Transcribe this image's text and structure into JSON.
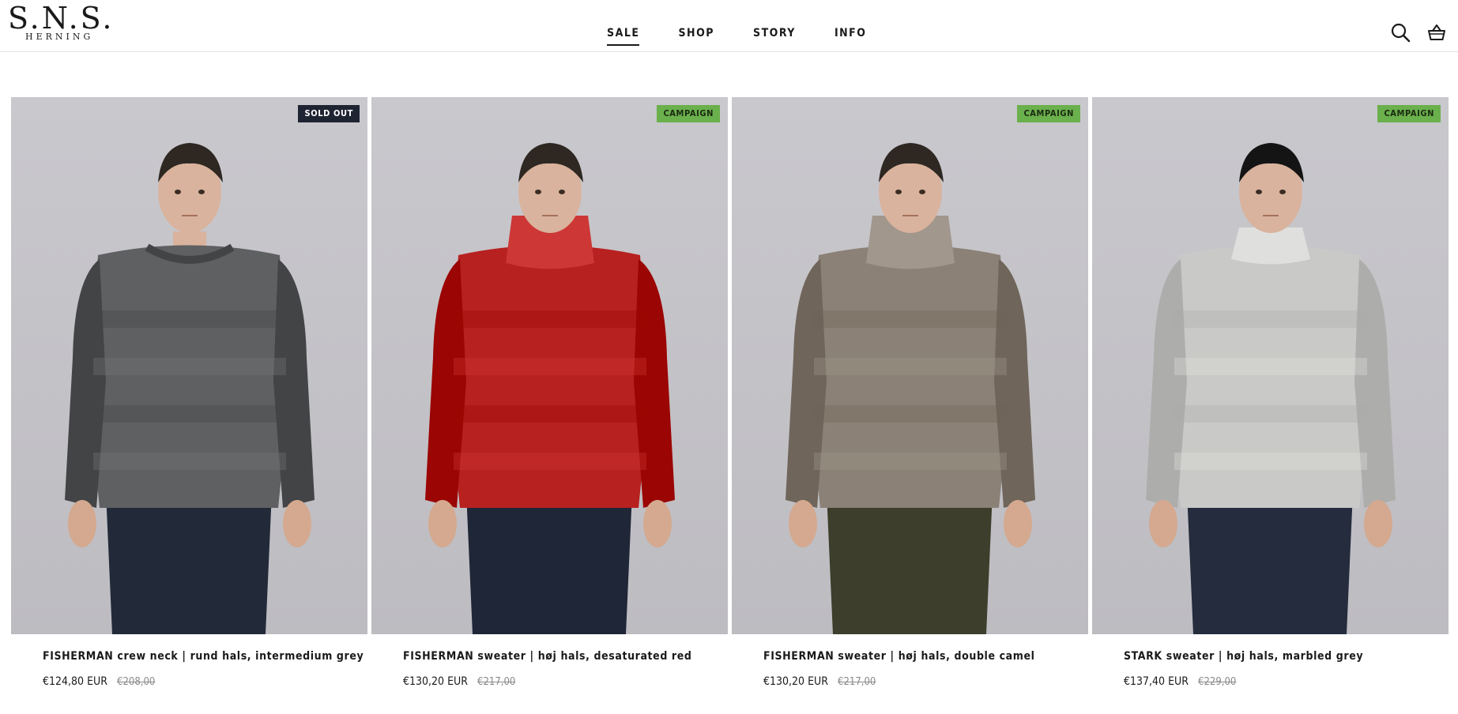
{
  "brand": {
    "logo_main": "S.N.S.",
    "logo_sub": "HERNING"
  },
  "nav": {
    "items": [
      {
        "label": "SALE",
        "active": true
      },
      {
        "label": "SHOP",
        "active": false
      },
      {
        "label": "STORY",
        "active": false
      },
      {
        "label": "INFO",
        "active": false
      }
    ]
  },
  "header_icons": [
    "search-icon",
    "basket-icon"
  ],
  "products": [
    {
      "badge": "SOLD OUT",
      "badge_type": "soldout",
      "title": "FISHERMAN crew neck | rund hals, intermedium grey",
      "price": "€124,80 EUR",
      "original_price": "€208,00",
      "sweater_color": "#5f6062",
      "pants_color": "#222a3a",
      "neck": "crew",
      "hat": false
    },
    {
      "badge": "CAMPAIGN",
      "badge_type": "campaign",
      "title": "FISHERMAN sweater | høj hals, desaturated red",
      "price": "€130,20 EUR",
      "original_price": "€217,00",
      "sweater_color": "#b7211f",
      "pants_color": "#1f2637",
      "neck": "turtle",
      "hat": false
    },
    {
      "badge": "CAMPAIGN",
      "badge_type": "campaign",
      "title": "FISHERMAN sweater | høj hals, double camel",
      "price": "€130,20 EUR",
      "original_price": "€217,00",
      "sweater_color": "#8b8176",
      "pants_color": "#3d3e2b",
      "neck": "turtle",
      "hat": false
    },
    {
      "badge": "CAMPAIGN",
      "badge_type": "campaign",
      "title": "STARK sweater | høj hals, marbled grey",
      "price": "€137,40 EUR",
      "original_price": "€229,00",
      "sweater_color": "#c9c9c7",
      "pants_color": "#242c3e",
      "neck": "mock",
      "hat": true
    }
  ]
}
